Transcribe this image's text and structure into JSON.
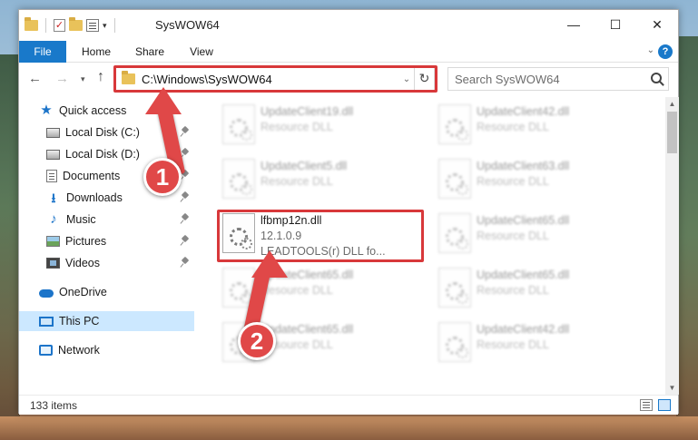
{
  "window": {
    "title": "SysWOW64",
    "minimize": "—",
    "maximize": "☐",
    "close": "✕"
  },
  "ribbon": {
    "tabs": [
      "File",
      "Home",
      "Share",
      "View"
    ],
    "help": "?"
  },
  "address": {
    "path": "C:\\Windows\\SysWOW64",
    "refresh": "↻"
  },
  "search": {
    "placeholder": "Search SysWOW64"
  },
  "sidebar": {
    "items": [
      {
        "label": "Quick access"
      },
      {
        "label": "Local Disk (C:)"
      },
      {
        "label": "Local Disk (D:)"
      },
      {
        "label": "Documents"
      },
      {
        "label": "Downloads"
      },
      {
        "label": "Music"
      },
      {
        "label": "Pictures"
      },
      {
        "label": "Videos"
      },
      {
        "label": "OneDrive"
      },
      {
        "label": "This PC"
      },
      {
        "label": "Network"
      }
    ]
  },
  "files": [
    {
      "name": "UpdateClient19.dll",
      "sub": "Resource DLL"
    },
    {
      "name": "UpdateClient42.dll",
      "sub": "Resource DLL"
    },
    {
      "name": "UpdateClient5.dll",
      "sub": "Resource DLL"
    },
    {
      "name": "UpdateClient63.dll",
      "sub": "Resource DLL"
    },
    {
      "name": "lfbmp12n.dll",
      "version": "12.1.0.9",
      "sub": "LEADTOOLS(r) DLL fo..."
    },
    {
      "name": "UpdateClient65.dll",
      "sub": "Resource DLL"
    },
    {
      "name": "UpdateClient65.dll",
      "sub": "Resource DLL"
    },
    {
      "name": "UpdateClient65.dll",
      "sub": "Resource DLL"
    },
    {
      "name": "UpdateClient65.dll",
      "sub": "Resource DLL"
    },
    {
      "name": "UpdateClient42.dll",
      "sub": "Resource DLL"
    }
  ],
  "status": {
    "count": "133 items"
  },
  "annotations": {
    "step1": "1",
    "step2": "2",
    "color": "#e04848"
  }
}
